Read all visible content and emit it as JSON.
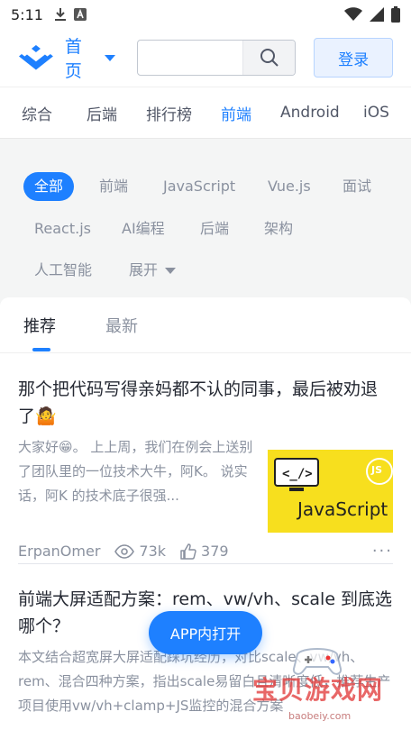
{
  "status_bar": {
    "time": "5:11"
  },
  "header": {
    "home_label": "首页",
    "search_placeholder": "",
    "login_label": "登录"
  },
  "top_nav": {
    "items": [
      "综合",
      "后端",
      "排行榜",
      "前端",
      "Android",
      "iOS"
    ],
    "active": "前端"
  },
  "tags": {
    "items": [
      "全部",
      "前端",
      "JavaScript",
      "Vue.js",
      "面试",
      "React.js",
      "AI编程",
      "后端",
      "架构",
      "人工智能",
      "展开"
    ],
    "active": "全部"
  },
  "sort_tabs": {
    "items": [
      "推荐",
      "最新"
    ],
    "active": "推荐"
  },
  "articles": [
    {
      "title": "那个把代码写得亲妈都不认的同事，最后被劝退了🤷",
      "abstract": "大家好😁。 上上周，我们在例会上送别了团队里的一位技术大牛，阿K。 说实话，阿K 的技术底子很强...",
      "thumb_text": "JavaScript",
      "thumb_badge": "JS",
      "author": "ErpanOmer",
      "views": "73k",
      "likes": "379",
      "more": "···"
    },
    {
      "title": "前端大屏适配方案：rem、vw/vh、scale 到底选哪个？",
      "abstract": "本文结合超宽屏大屏适配踩坑经历，对比scale、vw/vh、rem、混合四种方案，指出scale易留白且清晰度低，推荐生产项目使用vw/vh+clamp+JS监控的混合方案"
    }
  ],
  "open_app_label": "APP内打开",
  "watermark": {
    "text": "宝贝游戏网",
    "url": "baobeiy.com"
  },
  "colors": {
    "accent": "#1e80ff",
    "text": "#252933",
    "muted": "#8a919f",
    "bg": "#f4f5f5"
  }
}
